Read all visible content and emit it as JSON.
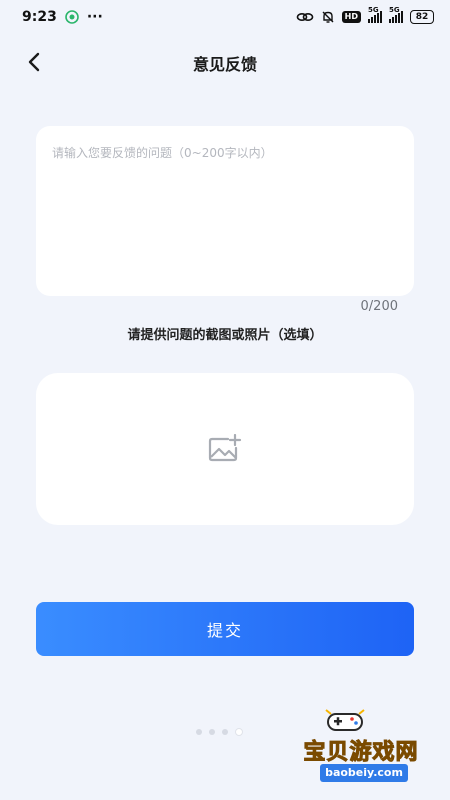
{
  "status_bar": {
    "time": "9:23",
    "more_dots": "···",
    "hd_label": "HD",
    "sig1_label": "5G",
    "sig2_label": "5G",
    "battery": "82",
    "icons": [
      "app-notification-icon",
      "link-icon",
      "mute-bell-icon",
      "signal-icon",
      "battery-icon"
    ]
  },
  "header": {
    "title": "意见反馈",
    "back_icon": "back-arrow-icon"
  },
  "feedback": {
    "placeholder": "请输入您要反馈的问题（0~200字以内）",
    "value": "",
    "count": "0/200"
  },
  "upload": {
    "label": "请提供问题的截图或照片（选填）",
    "icon": "add-image-icon"
  },
  "submit": {
    "label": "提交",
    "gradient_start": "#3a8dff",
    "gradient_end": "#1e63f5"
  },
  "pager": {
    "dots": 4,
    "active_index": 3
  },
  "watermark": {
    "title": "宝贝游戏网",
    "url": "baobeiy.com"
  }
}
